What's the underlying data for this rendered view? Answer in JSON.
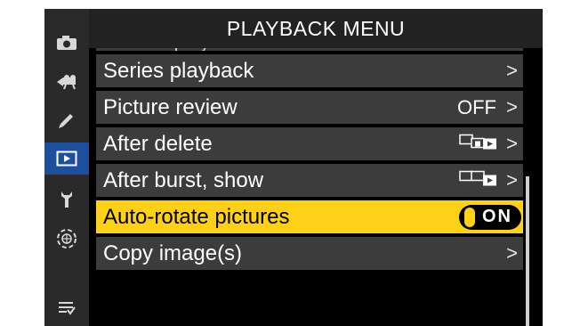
{
  "header": {
    "title": "PLAYBACK MENU"
  },
  "tabs": [
    {
      "icon": "camera-icon",
      "active": false
    },
    {
      "icon": "movie-camera-icon",
      "active": false
    },
    {
      "icon": "pencil-icon",
      "active": false
    },
    {
      "icon": "playback-icon",
      "active": true
    },
    {
      "icon": "wrench-icon",
      "active": false
    },
    {
      "icon": "network-icon",
      "active": false
    },
    {
      "icon": "my-menu-icon",
      "active": false
    }
  ],
  "menu": {
    "partial_item": "Filtered playback criteria",
    "items": [
      {
        "label": "Series playback",
        "value": "",
        "icon": "",
        "chevron": ">"
      },
      {
        "label": "Picture review",
        "value": "OFF",
        "icon": "",
        "chevron": ">"
      },
      {
        "label": "After delete",
        "value": "",
        "icon": "after-delete-icon",
        "chevron": ">"
      },
      {
        "label": "After burst, show",
        "value": "",
        "icon": "after-burst-icon",
        "chevron": ">"
      },
      {
        "label": "Auto-rotate pictures",
        "value": "ON",
        "icon": "toggle-icon",
        "chevron": "",
        "selected": true
      },
      {
        "label": "Copy image(s)",
        "value": "",
        "icon": "",
        "chevron": ">"
      }
    ]
  },
  "colors": {
    "selection": "#fcd117",
    "active_tab": "#1d4f9a",
    "row_background": "#3c3c3c"
  }
}
